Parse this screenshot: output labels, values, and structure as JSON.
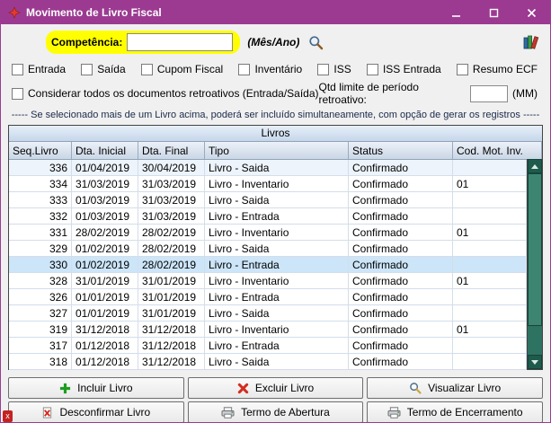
{
  "window": {
    "title": "Movimento de Livro Fiscal"
  },
  "competencia": {
    "label": "Competência:",
    "value": "",
    "mes_ano": "(Mês/Ano)"
  },
  "filters": {
    "types": [
      "Entrada",
      "Saída",
      "Cupom Fiscal",
      "Inventário",
      "ISS",
      "ISS Entrada",
      "Resumo ECF"
    ],
    "retroativos_label": "Considerar todos os documentos retroativos (Entrada/Saída)",
    "qtd_limite_label": "Qtd limite de período retroativo:",
    "qtd_limite_value": "",
    "qtd_limite_unit": "(MM)"
  },
  "info_line": "-----  Se selecionado mais de um Livro acima, poderá ser incluído simultaneamente, com opção de gerar os registros  -----",
  "table": {
    "title": "Livros",
    "columns": [
      "Seq.Livro",
      "Dta. Inicial",
      "Dta. Final",
      "Tipo",
      "Status",
      "Cod. Mot. Inv."
    ],
    "selected_row_index": 6,
    "rows": [
      [
        "336",
        "01/04/2019",
        "30/04/2019",
        "Livro - Saida",
        "Confirmado",
        ""
      ],
      [
        "334",
        "31/03/2019",
        "31/03/2019",
        "Livro - Inventario",
        "Confirmado",
        "01"
      ],
      [
        "333",
        "01/03/2019",
        "31/03/2019",
        "Livro - Saida",
        "Confirmado",
        ""
      ],
      [
        "332",
        "01/03/2019",
        "31/03/2019",
        "Livro - Entrada",
        "Confirmado",
        ""
      ],
      [
        "331",
        "28/02/2019",
        "28/02/2019",
        "Livro - Inventario",
        "Confirmado",
        "01"
      ],
      [
        "329",
        "01/02/2019",
        "28/02/2019",
        "Livro - Saida",
        "Confirmado",
        ""
      ],
      [
        "330",
        "01/02/2019",
        "28/02/2019",
        "Livro - Entrada",
        "Confirmado",
        ""
      ],
      [
        "328",
        "31/01/2019",
        "31/01/2019",
        "Livro - Inventario",
        "Confirmado",
        "01"
      ],
      [
        "326",
        "01/01/2019",
        "31/01/2019",
        "Livro - Entrada",
        "Confirmado",
        ""
      ],
      [
        "327",
        "01/01/2019",
        "31/01/2019",
        "Livro - Saida",
        "Confirmado",
        ""
      ],
      [
        "319",
        "31/12/2018",
        "31/12/2018",
        "Livro - Inventario",
        "Confirmado",
        "01"
      ],
      [
        "317",
        "01/12/2018",
        "31/12/2018",
        "Livro - Entrada",
        "Confirmado",
        ""
      ],
      [
        "318",
        "01/12/2018",
        "31/12/2018",
        "Livro - Saida",
        "Confirmado",
        ""
      ]
    ]
  },
  "actions": {
    "incluir": "Incluir Livro",
    "excluir": "Excluir Livro",
    "visualizar": "Visualizar Livro",
    "desconfirmar": "Desconfirmar Livro",
    "abertura": "Termo de Abertura",
    "encerramento": "Termo de Encerramento"
  },
  "colors": {
    "titlebar": "#9C3A92",
    "highlight": "#FFFF00",
    "scrollbar": "#2E7261",
    "scrollbar_dark": "#1E5B4C",
    "selected_row": "#CCE5F8"
  }
}
